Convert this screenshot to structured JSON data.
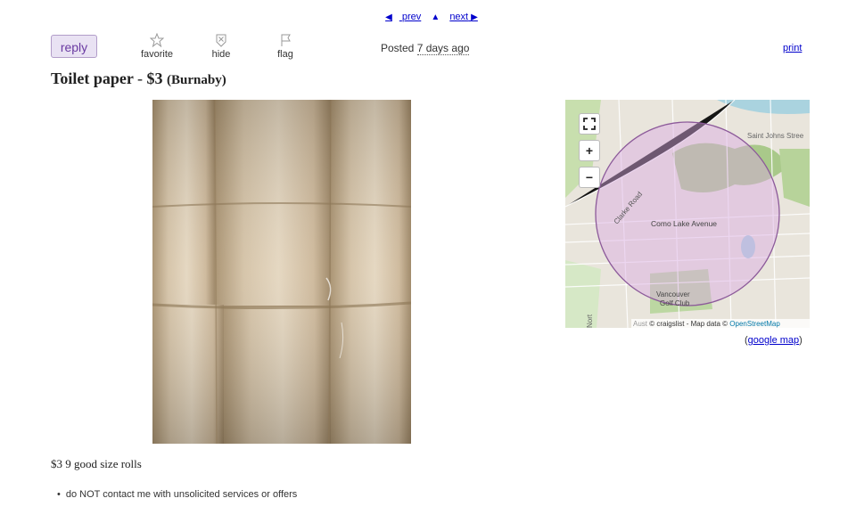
{
  "nav": {
    "prev": "prev",
    "up": "▲",
    "next": "next",
    "prev_arrow": "◀",
    "next_arrow": "▶"
  },
  "actions": {
    "reply": "reply",
    "favorite": "favorite",
    "hide": "hide",
    "flag": "flag",
    "print": "print"
  },
  "posted": {
    "label": "Posted",
    "ago": "7 days ago"
  },
  "post": {
    "title": "Toilet paper",
    "price": "$3",
    "location": "(Burnaby)"
  },
  "map": {
    "labels": {
      "saint_johns": "Saint Johns Stree",
      "clarke": "Clarke Road",
      "como": "Como Lake Avenue",
      "golf1": "Vancouver",
      "golf2": "Golf Club",
      "north": "Nort"
    },
    "attribution_prefix": "Aust ",
    "attribution": "© craigslist - Map data ©",
    "osm": "OpenStreetMap",
    "zoom_in": "+",
    "zoom_out": "−",
    "google_map": "google map",
    "google_map_open": "(",
    "google_map_close": ")"
  },
  "body": "$3 9 good size rolls",
  "notice": "do NOT contact me with unsolicited services or offers",
  "colors": {
    "accent": "#6a3aa2",
    "link": "#0000cc",
    "circle": "#9c6aa8"
  }
}
